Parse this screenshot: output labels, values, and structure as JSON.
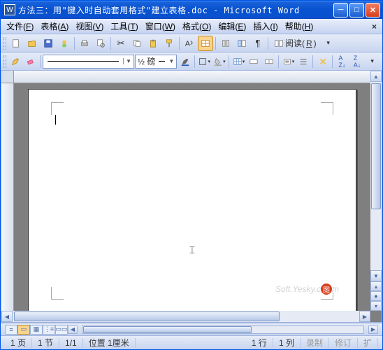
{
  "title": "方法三：用\"键入时自动套用格式\"建立表格.doc - Microsoft Word",
  "menus": {
    "file": "文件(",
    "file_u": "F",
    "file_e": ")",
    "table": "表格(",
    "table_u": "A",
    "table_e": ")",
    "view": "视图(",
    "view_u": "V",
    "view_e": ")",
    "tools": "工具(",
    "tools_u": "T",
    "tools_e": ")",
    "window": "窗口(",
    "window_u": "W",
    "window_e": ")",
    "format": "格式(",
    "format_u": "O",
    "format_e": ")",
    "edit": "编辑(",
    "edit_u": "E",
    "edit_e": ")",
    "insert": "插入(",
    "insert_u": "I",
    "insert_e": ")",
    "help": "帮助(",
    "help_u": "H",
    "help_e": ")"
  },
  "toolbar2": {
    "weight_label": "½ 磅",
    "reading": "阅读(",
    "reading_u": "R",
    "reading_e": ")"
  },
  "watermark": {
    "a": "Soft.Yesky.c",
    "b": "图",
    "c": "m"
  },
  "status": {
    "page": "1 页",
    "section": "1 节",
    "pageof": "1/1",
    "pos": "位置 1厘米",
    "line": "1 行",
    "col": "1 列",
    "rec": "录制",
    "rev": "修订",
    "ext": "扩"
  }
}
